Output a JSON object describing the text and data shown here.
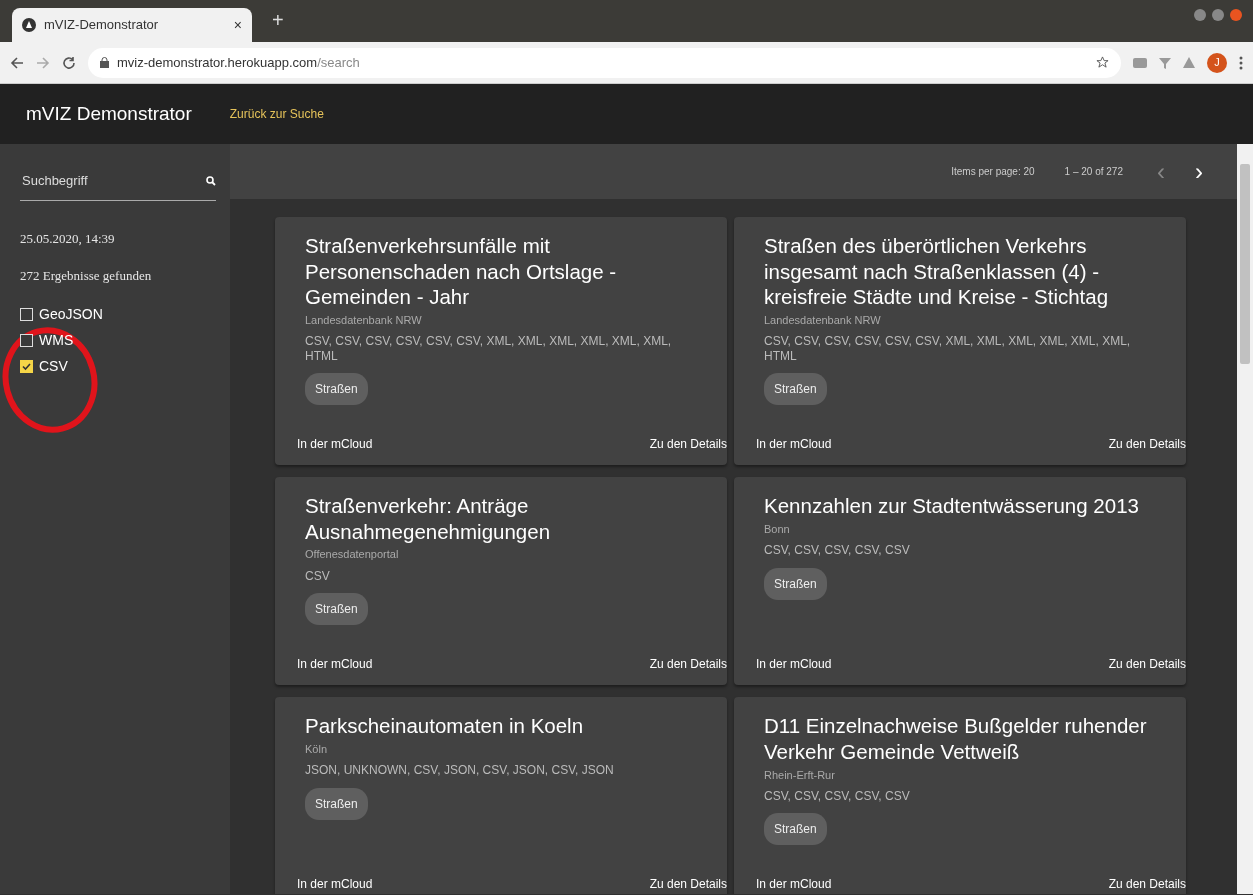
{
  "browser": {
    "tab_title": "mVIZ-Demonstrator",
    "tab_close": "×",
    "new_tab": "+",
    "url_host": "mviz-demonstrator.herokuapp.com",
    "url_path": "/search",
    "avatar_letter": "J"
  },
  "navbar": {
    "brand": "mVIZ Demonstrator",
    "link": "Zurück zur Suche"
  },
  "sidebar": {
    "search": {
      "placeholder": "Suchbegriff"
    },
    "timestamp": "25.05.2020, 14:39",
    "result_count": "272 Ergebnisse gefunden",
    "filters": [
      {
        "label": "GeoJSON",
        "checked": false
      },
      {
        "label": "WMS",
        "checked": false
      },
      {
        "label": "CSV",
        "checked": true
      }
    ]
  },
  "paginator": {
    "items_per_page": "Items per page: 20",
    "range": "1 – 20 of 272",
    "prev": "‹",
    "next": "›"
  },
  "cards": [
    {
      "title": "Straßenverkehrsunfälle mit Personenschaden nach Ortslage - Gemeinden - Jahr",
      "source": "Landesdatenbank NRW",
      "formats": "CSV, CSV, CSV, CSV, CSV, CSV, XML, XML, XML, XML, XML, XML, HTML",
      "tag": "Straßen",
      "link_left": "In der mCloud",
      "link_right": "Zu den Details"
    },
    {
      "title": "Straßen des überörtlichen Verkehrs insgesamt nach Straßenklassen (4) - kreisfreie Städte und Kreise - Stichtag",
      "source": "Landesdatenbank NRW",
      "formats": "CSV, CSV, CSV, CSV, CSV, CSV, XML, XML, XML, XML, XML, XML, HTML",
      "tag": "Straßen",
      "link_left": "In der mCloud",
      "link_right": "Zu den Details"
    },
    {
      "title": "Straßenverkehr: Anträge Ausnahmegenehmigungen",
      "source": "Offenesdatenportal",
      "formats": "CSV",
      "tag": "Straßen",
      "link_left": "In der mCloud",
      "link_right": "Zu den Details"
    },
    {
      "title": "Kennzahlen zur Stadtentwässerung 2013",
      "source": "Bonn",
      "formats": "CSV, CSV, CSV, CSV, CSV",
      "tag": "Straßen",
      "link_left": "In der mCloud",
      "link_right": "Zu den Details"
    },
    {
      "title": "Parkscheinautomaten in Koeln",
      "source": "Köln",
      "formats": "JSON, UNKNOWN, CSV, JSON, CSV, JSON, CSV, JSON",
      "tag": "Straßen",
      "link_left": "In der mCloud",
      "link_right": "Zu den Details"
    },
    {
      "title": "D11 Einzelnachweise Bußgelder ruhender Verkehr Gemeinde Vettweiß",
      "source": "Rhein-Erft-Rur",
      "formats": "CSV, CSV, CSV, CSV, CSV",
      "tag": "Straßen",
      "link_left": "In der mCloud",
      "link_right": "Zu den Details"
    }
  ]
}
